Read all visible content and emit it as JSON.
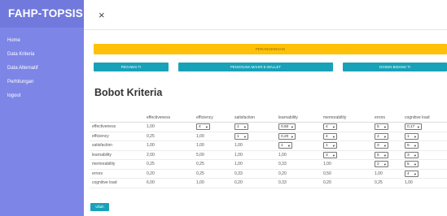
{
  "app": {
    "brand": "FAHP-TOPSIS"
  },
  "sidebar": {
    "items": [
      {
        "label": "Home"
      },
      {
        "label": "Data Kriteria"
      },
      {
        "label": "Data Alternatif"
      },
      {
        "label": "Perhitungan"
      },
      {
        "label": "logout"
      }
    ]
  },
  "topbar": {
    "close_icon": "×"
  },
  "banner": {
    "label": "PERANGKINGAN"
  },
  "buttons": [
    {
      "label": "PEGAWAI TI"
    },
    {
      "label": "PENGGUNA MAHIR E-WALLET"
    },
    {
      "label": "DOSEN BIDANG TI"
    }
  ],
  "page": {
    "title": "Bobot Kriteria"
  },
  "table": {
    "columns": [
      "",
      "effectiveness",
      "efficiency",
      "satisfaction",
      "learnability",
      "memorability",
      "errors",
      "cognitive load"
    ],
    "rows": [
      {
        "label": "effectiveness",
        "cells": [
          {
            "v": "1,00",
            "sel": false
          },
          {
            "v": "4",
            "sel": true
          },
          {
            "v": "1",
            "sel": true
          },
          {
            "v": "0,50",
            "sel": true
          },
          {
            "v": "4",
            "sel": true
          },
          {
            "v": "5",
            "sel": true
          },
          {
            "v": "0,17",
            "sel": true
          }
        ]
      },
      {
        "label": "efficiency",
        "cells": [
          {
            "v": "0,25",
            "sel": false
          },
          {
            "v": "1,00",
            "sel": false
          },
          {
            "v": "1",
            "sel": true
          },
          {
            "v": "0,20",
            "sel": true
          },
          {
            "v": "4",
            "sel": true
          },
          {
            "v": "4",
            "sel": true
          },
          {
            "v": "1",
            "sel": true
          }
        ]
      },
      {
        "label": "satisfaction",
        "cells": [
          {
            "v": "1,00",
            "sel": false
          },
          {
            "v": "1,00",
            "sel": false
          },
          {
            "v": "1,00",
            "sel": false
          },
          {
            "v": "1",
            "sel": true
          },
          {
            "v": "1",
            "sel": true
          },
          {
            "v": "3",
            "sel": true
          },
          {
            "v": "5",
            "sel": true
          }
        ]
      },
      {
        "label": "learnability",
        "cells": [
          {
            "v": "2,00",
            "sel": false
          },
          {
            "v": "5,00",
            "sel": false
          },
          {
            "v": "1,00",
            "sel": false
          },
          {
            "v": "1,00",
            "sel": false
          },
          {
            "v": "3",
            "sel": true
          },
          {
            "v": "5",
            "sel": true
          },
          {
            "v": "3",
            "sel": true
          }
        ]
      },
      {
        "label": "memorability",
        "cells": [
          {
            "v": "0,25",
            "sel": false
          },
          {
            "v": "0,25",
            "sel": false
          },
          {
            "v": "1,00",
            "sel": false
          },
          {
            "v": "0,33",
            "sel": false
          },
          {
            "v": "1,00",
            "sel": false
          },
          {
            "v": "2",
            "sel": true
          },
          {
            "v": "5",
            "sel": true
          }
        ]
      },
      {
        "label": "errors",
        "cells": [
          {
            "v": "0,20",
            "sel": false
          },
          {
            "v": "0,25",
            "sel": false
          },
          {
            "v": "0,33",
            "sel": false
          },
          {
            "v": "0,20",
            "sel": false
          },
          {
            "v": "0,50",
            "sel": false
          },
          {
            "v": "1,00",
            "sel": false
          },
          {
            "v": "4",
            "sel": true
          }
        ]
      },
      {
        "label": "cognitive load",
        "cells": [
          {
            "v": "6,00",
            "sel": false
          },
          {
            "v": "1,00",
            "sel": false
          },
          {
            "v": "0,20",
            "sel": false
          },
          {
            "v": "0,33",
            "sel": false
          },
          {
            "v": "0,20",
            "sel": false
          },
          {
            "v": "0,25",
            "sel": false
          },
          {
            "v": "1,00",
            "sel": false
          }
        ]
      }
    ]
  },
  "footer": {
    "submit_label": "Ubah"
  }
}
